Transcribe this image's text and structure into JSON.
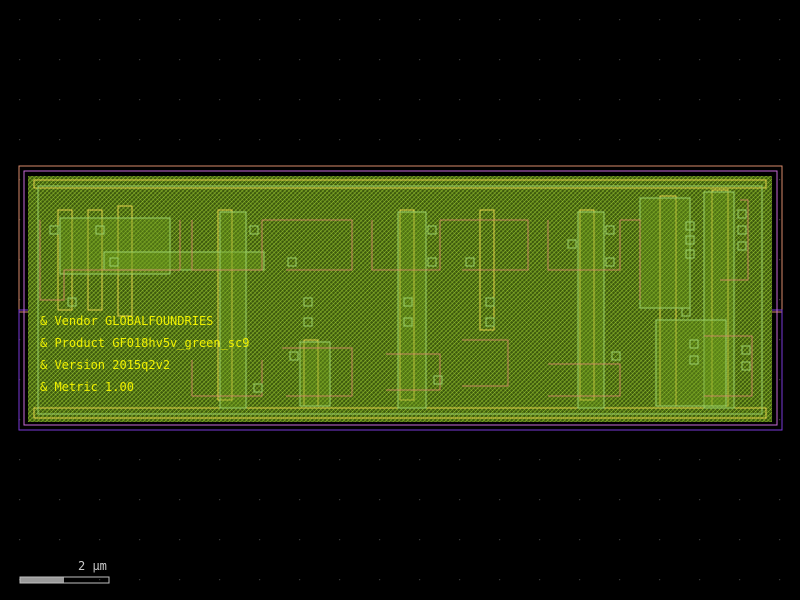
{
  "colors": {
    "background": "#000000",
    "grid_dot": "#3a3a3a",
    "substrate": "#7aa81e",
    "nwell_outline": "#d98a6a",
    "pwell_outline": "#7a3ad8",
    "poly": "#e2d04a",
    "metal": "#9a78c8",
    "contact": "#9bd06a",
    "annotation_text": "#f0f000",
    "scale_bar": "#c0c0c0"
  },
  "layout_annotations": [
    {
      "label": "& Vendor GLOBALFOUNDRIES"
    },
    {
      "label": "& Product GF018hv5v_green_sc9"
    },
    {
      "label": "& Version 2015q2v2"
    },
    {
      "label": "& Metric 1.00"
    }
  ],
  "scale_bar": {
    "label": "2 µm"
  }
}
